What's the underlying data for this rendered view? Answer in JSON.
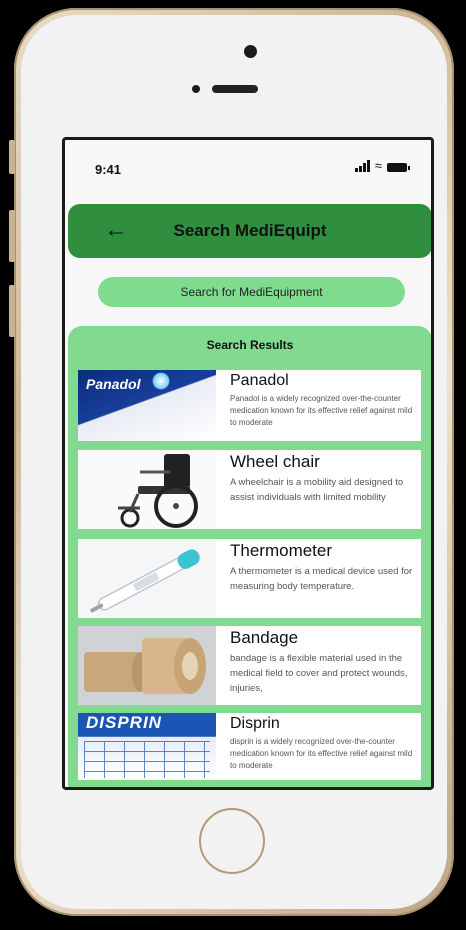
{
  "status": {
    "time": "9:41"
  },
  "header": {
    "title": "Search MediEquipt",
    "back_icon": "arrow-left-icon"
  },
  "search": {
    "placeholder": "Search for MediEquipment"
  },
  "results": {
    "title": "Search Results",
    "items": [
      {
        "name": "Panadol",
        "description": "Panadol is a widely recognized over-the-counter medication  known for its effective relief against mild to moderate"
      },
      {
        "name": "Wheel chair",
        "description": "A wheelchair is a mobility aid designed to assist individuals with limited mobility"
      },
      {
        "name": "Thermometer",
        "description": "A thermometer is a medical device used for measuring body temperature."
      },
      {
        "name": "Bandage",
        "description": "bandage is a flexible material used in the medical field to cover and protect wounds, injuries,"
      },
      {
        "name": "Disprin",
        "description": "disprin is a widely recognized over-the-counter medication  known for its effective relief against mild to moderate"
      }
    ]
  },
  "images": {
    "panadol_brand": "Panadol",
    "disprin_brand": "DISPRIN"
  },
  "colors": {
    "header": "#2f8f3f",
    "search_bar": "#7fdc8e",
    "results_panel": "#82d990"
  }
}
